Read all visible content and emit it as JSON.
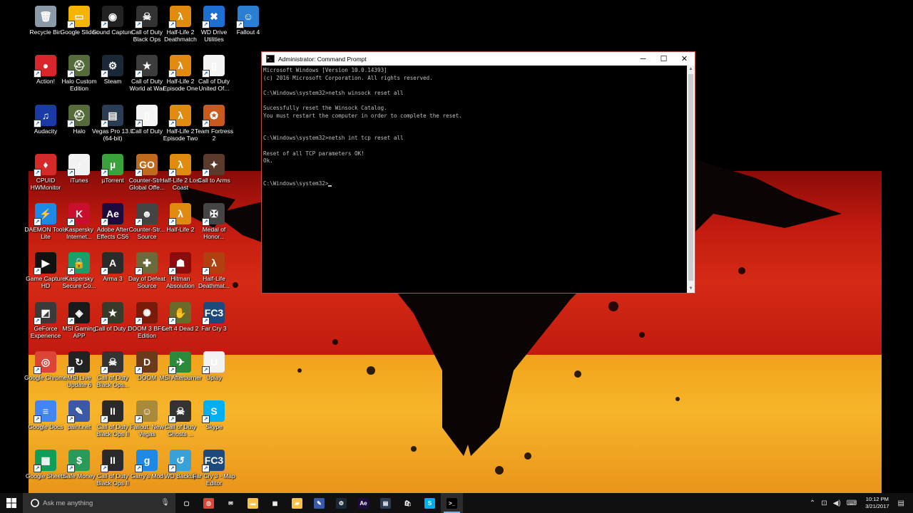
{
  "desktop": {
    "icons": [
      {
        "label": "Recycle Bin",
        "icon": "recycle-bin-icon",
        "color": "#8a9aa8",
        "glyph": "🗑"
      },
      {
        "label": "Google Slides",
        "icon": "google-slides-icon",
        "color": "#f4b400",
        "glyph": "▭"
      },
      {
        "label": "Sound Capture",
        "icon": "sound-capture-icon",
        "color": "#222222",
        "glyph": "◉"
      },
      {
        "label": "Call of Duty Black Ops",
        "icon": "call-of-duty-black-ops-icon",
        "color": "#333333",
        "glyph": "☠"
      },
      {
        "label": "Half-Life 2 Deathmatch",
        "icon": "half-life-2-icon",
        "color": "#e08a10",
        "glyph": "λ"
      },
      {
        "label": "WD Drive Utilities",
        "icon": "wd-drive-utilities-icon",
        "color": "#1d6fd1",
        "glyph": "✖"
      },
      {
        "label": "Fallout 4",
        "icon": "fallout-4-icon",
        "color": "#2a7fd4",
        "glyph": "☺"
      },
      {
        "label": "Action!",
        "icon": "action-icon",
        "color": "#d8262c",
        "glyph": "●"
      },
      {
        "label": "Halo Custom Edition",
        "icon": "halo-custom-edition-icon",
        "color": "#556b3a",
        "glyph": "⛑"
      },
      {
        "label": "Steam",
        "icon": "steam-icon",
        "color": "#1b2838",
        "glyph": "⚙"
      },
      {
        "label": "Call of Duty World at War",
        "icon": "call-of-duty-world-at-war-icon",
        "color": "#3c3c3c",
        "glyph": "★"
      },
      {
        "label": "Half-Life 2 Episode One",
        "icon": "half-life-2-episode-one-icon",
        "color": "#e08a10",
        "glyph": "λ"
      },
      {
        "label": "Call of Duty United Of...",
        "icon": "call-of-duty-united-offensive-icon",
        "color": "#f4f4f4",
        "glyph": "▯"
      },
      {
        "label": "Audacity",
        "icon": "audacity-icon",
        "color": "#1a3aa6",
        "glyph": "♫"
      },
      {
        "label": "Halo",
        "icon": "halo-icon",
        "color": "#556b3a",
        "glyph": "⛑"
      },
      {
        "label": "Vegas Pro 13.0 (64-bit)",
        "icon": "vegas-pro-icon",
        "color": "#2a3d55",
        "glyph": "▤"
      },
      {
        "label": "Call of Duty",
        "icon": "call-of-duty-icon",
        "color": "#f4f4f4",
        "glyph": "▯"
      },
      {
        "label": "Half-Life 2 Episode Two",
        "icon": "half-life-2-episode-two-icon",
        "color": "#e08a10",
        "glyph": "λ"
      },
      {
        "label": "Team Fortress 2",
        "icon": "team-fortress-2-icon",
        "color": "#c85a1e",
        "glyph": "✪"
      },
      {
        "label": "CPUID HWMonitor",
        "icon": "cpuid-hwmonitor-icon",
        "color": "#d42a2a",
        "glyph": "♦"
      },
      {
        "label": "iTunes",
        "icon": "itunes-icon",
        "color": "#f2f2f2",
        "glyph": "♪"
      },
      {
        "label": "µTorrent",
        "icon": "utorrent-icon",
        "color": "#3aa23a",
        "glyph": "µ"
      },
      {
        "label": "Counter-Str... Global Offe...",
        "icon": "counter-strike-go-icon",
        "color": "#c06a1e",
        "glyph": "GO"
      },
      {
        "label": "Half-Life 2 Lost Coast",
        "icon": "half-life-2-lost-coast-icon",
        "color": "#e08a10",
        "glyph": "λ"
      },
      {
        "label": "Call to Arms",
        "icon": "call-to-arms-icon",
        "color": "#5a3a2a",
        "glyph": "✦"
      },
      {
        "label": "DAEMON Tools Lite",
        "icon": "daemon-tools-lite-icon",
        "color": "#1e88e5",
        "glyph": "⚡"
      },
      {
        "label": "Kaspersky Internet...",
        "icon": "kaspersky-internet-security-icon",
        "color": "#c8102e",
        "glyph": "K"
      },
      {
        "label": "Adobe After Effects CS6",
        "icon": "after-effects-icon",
        "color": "#1f0a3c",
        "glyph": "Ae"
      },
      {
        "label": "Counter-Str... Source",
        "icon": "counter-strike-source-icon",
        "color": "#444444",
        "glyph": "☻"
      },
      {
        "label": "Half-Life 2",
        "icon": "half-life-2-main-icon",
        "color": "#e08a10",
        "glyph": "λ"
      },
      {
        "label": "Medal of Honor...",
        "icon": "medal-of-honor-icon",
        "color": "#444444",
        "glyph": "✠"
      },
      {
        "label": "Game Capture HD",
        "icon": "game-capture-hd-icon",
        "color": "#111111",
        "glyph": "▶"
      },
      {
        "label": "Kaspersky Secure Co...",
        "icon": "kaspersky-secure-connection-icon",
        "color": "#1a9e6a",
        "glyph": "🔒"
      },
      {
        "label": "Arma 3",
        "icon": "arma-3-icon",
        "color": "#2b2b2b",
        "glyph": "A"
      },
      {
        "label": "Day of Defeat Source",
        "icon": "day-of-defeat-source-icon",
        "color": "#6a6a3a",
        "glyph": "✚"
      },
      {
        "label": "Hitman Absolution",
        "icon": "hitman-absolution-icon",
        "color": "#8a0c0c",
        "glyph": "☗"
      },
      {
        "label": "Half-Life Deathmat...",
        "icon": "half-life-deathmatch-icon",
        "color": "#b04010",
        "glyph": "λ"
      },
      {
        "label": "GeForce Experience",
        "icon": "geforce-experience-icon",
        "color": "#3a3a3a",
        "glyph": "◩"
      },
      {
        "label": "MSI Gaming APP",
        "icon": "msi-gaming-app-icon",
        "color": "#1a1a1a",
        "glyph": "◈"
      },
      {
        "label": "Call of Duty 2",
        "icon": "call-of-duty-2-icon",
        "color": "#3a3a2a",
        "glyph": "★"
      },
      {
        "label": "DOOM 3 BFG Edition",
        "icon": "doom-3-bfg-icon",
        "color": "#7a1a0a",
        "glyph": "✺"
      },
      {
        "label": "Left 4 Dead 2",
        "icon": "left-4-dead-2-icon",
        "color": "#6a6a2a",
        "glyph": "✋"
      },
      {
        "label": "Far Cry 3",
        "icon": "far-cry-3-icon",
        "color": "#1d4a7a",
        "glyph": "FC3"
      },
      {
        "label": "Google Chrome",
        "icon": "google-chrome-icon",
        "color": "#db4437",
        "glyph": "◎"
      },
      {
        "label": "MSI Live Update 6",
        "icon": "msi-live-update-icon",
        "color": "#222222",
        "glyph": "↻"
      },
      {
        "label": "Call of Duty Black Ops...",
        "icon": "call-of-duty-black-ops-2-icon",
        "color": "#333333",
        "glyph": "☠"
      },
      {
        "label": "DOOM",
        "icon": "doom-icon",
        "color": "#6a3a1a",
        "glyph": "D"
      },
      {
        "label": "MSI Afterburner",
        "icon": "msi-afterburner-icon",
        "color": "#2a8a3a",
        "glyph": "✈"
      },
      {
        "label": "Uplay",
        "icon": "uplay-icon",
        "color": "#f2f2f2",
        "glyph": "U"
      },
      {
        "label": "Google Docs",
        "icon": "google-docs-icon",
        "color": "#4285f4",
        "glyph": "≡"
      },
      {
        "label": "paint.net",
        "icon": "paint-net-icon",
        "color": "#3a5aa8",
        "glyph": "✎"
      },
      {
        "label": "Call of Duty Black Ops II",
        "icon": "call-of-duty-black-ops-ii-icon",
        "color": "#2a2a2a",
        "glyph": "II"
      },
      {
        "label": "Fallout: New Vegas",
        "icon": "fallout-new-vegas-icon",
        "color": "#a88a3a",
        "glyph": "☺"
      },
      {
        "label": "Call of Duty Ghosts ...",
        "icon": "call-of-duty-ghosts-icon",
        "color": "#333333",
        "glyph": "☠"
      },
      {
        "label": "Skype",
        "icon": "skype-icon",
        "color": "#00aff0",
        "glyph": "S"
      },
      {
        "label": "Google Sheets",
        "icon": "google-sheets-icon",
        "color": "#0f9d58",
        "glyph": "▦"
      },
      {
        "label": "Safe Money",
        "icon": "safe-money-icon",
        "color": "#2a9a5a",
        "glyph": "$"
      },
      {
        "label": "Call of Duty Black Ops II",
        "icon": "call-of-duty-black-ops-ii-mp-icon",
        "color": "#2a2a2a",
        "glyph": "II"
      },
      {
        "label": "Garry's Mod",
        "icon": "garrys-mod-icon",
        "color": "#1e88e5",
        "glyph": "g"
      },
      {
        "label": "WD Backup",
        "icon": "wd-backup-icon",
        "color": "#3aa0d8",
        "glyph": "↺"
      },
      {
        "label": "Far Cry 3 - Map Editor",
        "icon": "far-cry-3-map-editor-icon",
        "color": "#1d4a7a",
        "glyph": "FC3"
      }
    ]
  },
  "cmd": {
    "title": "Administrator: Command Prompt",
    "console": "Microsoft Windows [Version 10.0.14393]\n(c) 2016 Microsoft Corporation. All rights reserved.\n\nC:\\Windows\\system32>netsh winsock reset all\n\nSucessfully reset the Winsock Catalog.\nYou must restart the computer in order to complete the reset.\n\n\nC:\\Windows\\system32>netsh int tcp reset all\n\nReset of all TCP parameters OK!\nOk.\n\n\nC:\\Windows\\system32>"
  },
  "taskbar": {
    "search_placeholder": "Ask me anything",
    "pinned": [
      {
        "icon": "task-view-icon",
        "color": "#101010",
        "glyph": "▢"
      },
      {
        "icon": "chrome-taskbar-icon",
        "color": "#db4437",
        "glyph": "◎"
      },
      {
        "icon": "mail-icon",
        "color": "#101010",
        "glyph": "✉"
      },
      {
        "icon": "file-explorer-icon",
        "color": "#f3c34a",
        "glyph": "▬"
      },
      {
        "icon": "calendar-icon",
        "color": "#101010",
        "glyph": "▦"
      },
      {
        "icon": "folder-icon",
        "color": "#f3c34a",
        "glyph": "▰"
      },
      {
        "icon": "paint-net-taskbar-icon",
        "color": "#3a5aa8",
        "glyph": "✎"
      },
      {
        "icon": "steam-taskbar-icon",
        "color": "#1b2838",
        "glyph": "⚙"
      },
      {
        "icon": "after-effects-taskbar-icon",
        "color": "#1f0a3c",
        "glyph": "Ae"
      },
      {
        "icon": "vegas-taskbar-icon",
        "color": "#2a3d55",
        "glyph": "▤"
      },
      {
        "icon": "store-icon",
        "color": "#101010",
        "glyph": "🛍"
      },
      {
        "icon": "skype-taskbar-icon",
        "color": "#00aff0",
        "glyph": "S"
      },
      {
        "icon": "command-prompt-taskbar-icon",
        "color": "#000000",
        "glyph": ">_",
        "active": true
      }
    ],
    "clock": {
      "time": "10:12 PM",
      "date": "3/21/2017"
    }
  }
}
